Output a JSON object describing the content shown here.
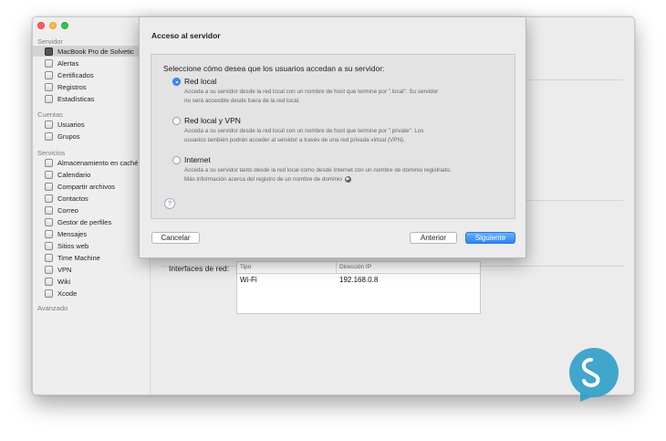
{
  "sidebar": {
    "sections": {
      "servidor": "Servidor",
      "cuentas": "Cuentas",
      "servicios": "Servicios",
      "avanzado": "Avanzado"
    },
    "server_items": [
      {
        "label": "MacBook Pro de Solvetic",
        "icon": "laptop-icon",
        "selected": true
      },
      {
        "label": "Alertas",
        "icon": "alert-icon"
      },
      {
        "label": "Certificados",
        "icon": "certificate-icon"
      },
      {
        "label": "Registros",
        "icon": "log-icon"
      },
      {
        "label": "Estadísticas",
        "icon": "stats-icon"
      }
    ],
    "account_items": [
      {
        "label": "Usuarios",
        "icon": "users-icon"
      },
      {
        "label": "Grupos",
        "icon": "groups-icon"
      }
    ],
    "service_items": [
      {
        "label": "Almacenamiento en caché",
        "icon": "cache-icon"
      },
      {
        "label": "Calendario",
        "icon": "calendar-icon"
      },
      {
        "label": "Compartir archivos",
        "icon": "file-sharing-icon"
      },
      {
        "label": "Contactos",
        "icon": "contacts-icon"
      },
      {
        "label": "Correo",
        "icon": "mail-icon"
      },
      {
        "label": "Gestor de perfiles",
        "icon": "profile-manager-icon"
      },
      {
        "label": "Mensajes",
        "icon": "messages-icon"
      },
      {
        "label": "Sitios web",
        "icon": "websites-icon"
      },
      {
        "label": "Time Machine",
        "icon": "time-machine-icon"
      },
      {
        "label": "VPN",
        "icon": "vpn-icon"
      },
      {
        "label": "Wiki",
        "icon": "wiki-icon"
      },
      {
        "label": "Xcode",
        "icon": "xcode-icon"
      }
    ]
  },
  "network": {
    "label": "Interfaces de red:",
    "columns": [
      "Tipo",
      "Dirección IP"
    ],
    "rows": [
      {
        "tipo": "Wi-Fi",
        "ip": "192.168.0.8"
      }
    ]
  },
  "sheet": {
    "title": "Acceso al servidor",
    "prompt": "Seleccione cómo desea que los usuarios accedan a su servidor:",
    "options": [
      {
        "label": "Red local",
        "selected": true,
        "desc1": "Acceda a su servidor desde la red local con un nombre de host que termine por \".local\". Su servidor",
        "desc2": "no será accesible desde fuera de la red local."
      },
      {
        "label": "Red local y VPN",
        "selected": false,
        "desc1": "Acceda a su servidor desde la red local con un nombre de host que termine por \".private\". Los",
        "desc2": "usuarios también podrán acceder al servidor a través de una red privada virtual (VPN)."
      },
      {
        "label": "Internet",
        "selected": false,
        "desc1": "Acceda a su servidor tanto desde la red local como desde Internet con un nombre de dominio registrado.",
        "desc2": "Más información acerca del registro de un nombre de dominio"
      }
    ],
    "help_label": "?",
    "buttons": {
      "cancel": "Cancelar",
      "back": "Anterior",
      "next": "Siguiente"
    }
  },
  "colors": {
    "accent": "#2a83f6",
    "logo": "#2f9fc8"
  }
}
